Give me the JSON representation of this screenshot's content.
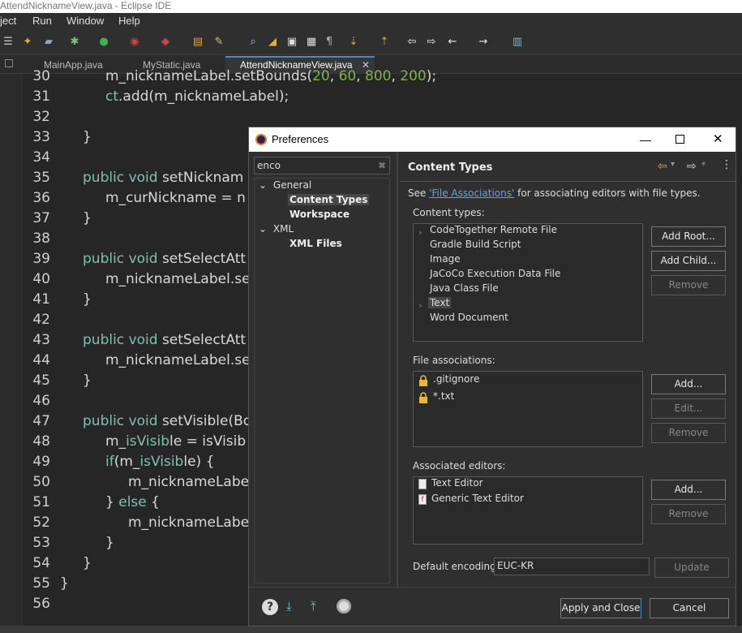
{
  "window": {
    "title": "AttendNicknameView.java - Eclipse IDE"
  },
  "menu": [
    "ject",
    "Run",
    "Window",
    "Help"
  ],
  "tabs": [
    {
      "label": "MainApp.java"
    },
    {
      "label": "MyStatic.java"
    },
    {
      "label": "AttendNicknameView.java",
      "active": true
    }
  ],
  "code": [
    {
      "n": "30",
      "text": "m_nicknameLabel.setBounds(20, 60, 800, 200);"
    },
    {
      "n": "31",
      "text": "ct.add(m_nicknameLabel);"
    },
    {
      "n": "32",
      "text": ""
    },
    {
      "n": "33",
      "text": "}"
    },
    {
      "n": "34",
      "text": ""
    },
    {
      "n": "35",
      "text": "public void setNicknam"
    },
    {
      "n": "36",
      "text": "m_curNickname = n"
    },
    {
      "n": "37",
      "text": "}"
    },
    {
      "n": "38",
      "text": ""
    },
    {
      "n": "39",
      "text": "public void setSelectAtt"
    },
    {
      "n": "40",
      "text": "m_nicknameLabel.se"
    },
    {
      "n": "41",
      "text": "}"
    },
    {
      "n": "42",
      "text": ""
    },
    {
      "n": "43",
      "text": "public void setSelectAtt"
    },
    {
      "n": "44",
      "text": "m_nicknameLabel.se"
    },
    {
      "n": "45",
      "text": "}"
    },
    {
      "n": "46",
      "text": ""
    },
    {
      "n": "47",
      "text": "public void setVisible(Bo"
    },
    {
      "n": "48",
      "text": "m_isVisible = isVisib"
    },
    {
      "n": "49",
      "text": "if(m_isVisible) {"
    },
    {
      "n": "50",
      "text": "m_nicknameLabe"
    },
    {
      "n": "51",
      "text": "} else {"
    },
    {
      "n": "52",
      "text": "m_nicknameLabe"
    },
    {
      "n": "53",
      "text": "}"
    },
    {
      "n": "54",
      "text": "}"
    },
    {
      "n": "55",
      "text": "}"
    },
    {
      "n": "56",
      "text": ""
    }
  ],
  "dialog": {
    "title": "Preferences",
    "filter": "enco",
    "tree": {
      "general": "General",
      "content_types": "Content Types",
      "workspace": "Workspace",
      "xml": "XML",
      "xml_files": "XML Files"
    },
    "page_title": "Content Types",
    "see_prefix": "See ",
    "see_link": "'File Associations'",
    "see_suffix": " for associating editors with file types.",
    "content_types_label": "Content types:",
    "content_types": [
      "CodeTogether Remote File",
      "Gradle Build Script",
      "Image",
      "JaCoCo Execution Data File",
      "Java Class File",
      "Text",
      "Word Document"
    ],
    "file_assoc_label": "File associations:",
    "file_assoc": [
      ".gitignore",
      "*.txt"
    ],
    "editors_label": "Associated editors:",
    "editors": [
      "Text Editor",
      "Generic Text Editor"
    ],
    "default_encoding_label": "Default encoding:",
    "default_encoding": "EUC-KR",
    "buttons": {
      "add_root": "Add Root...",
      "add_child": "Add Child...",
      "remove": "Remove",
      "add": "Add...",
      "edit": "Edit...",
      "update": "Update",
      "apply_close": "Apply and Close",
      "cancel": "Cancel"
    }
  }
}
